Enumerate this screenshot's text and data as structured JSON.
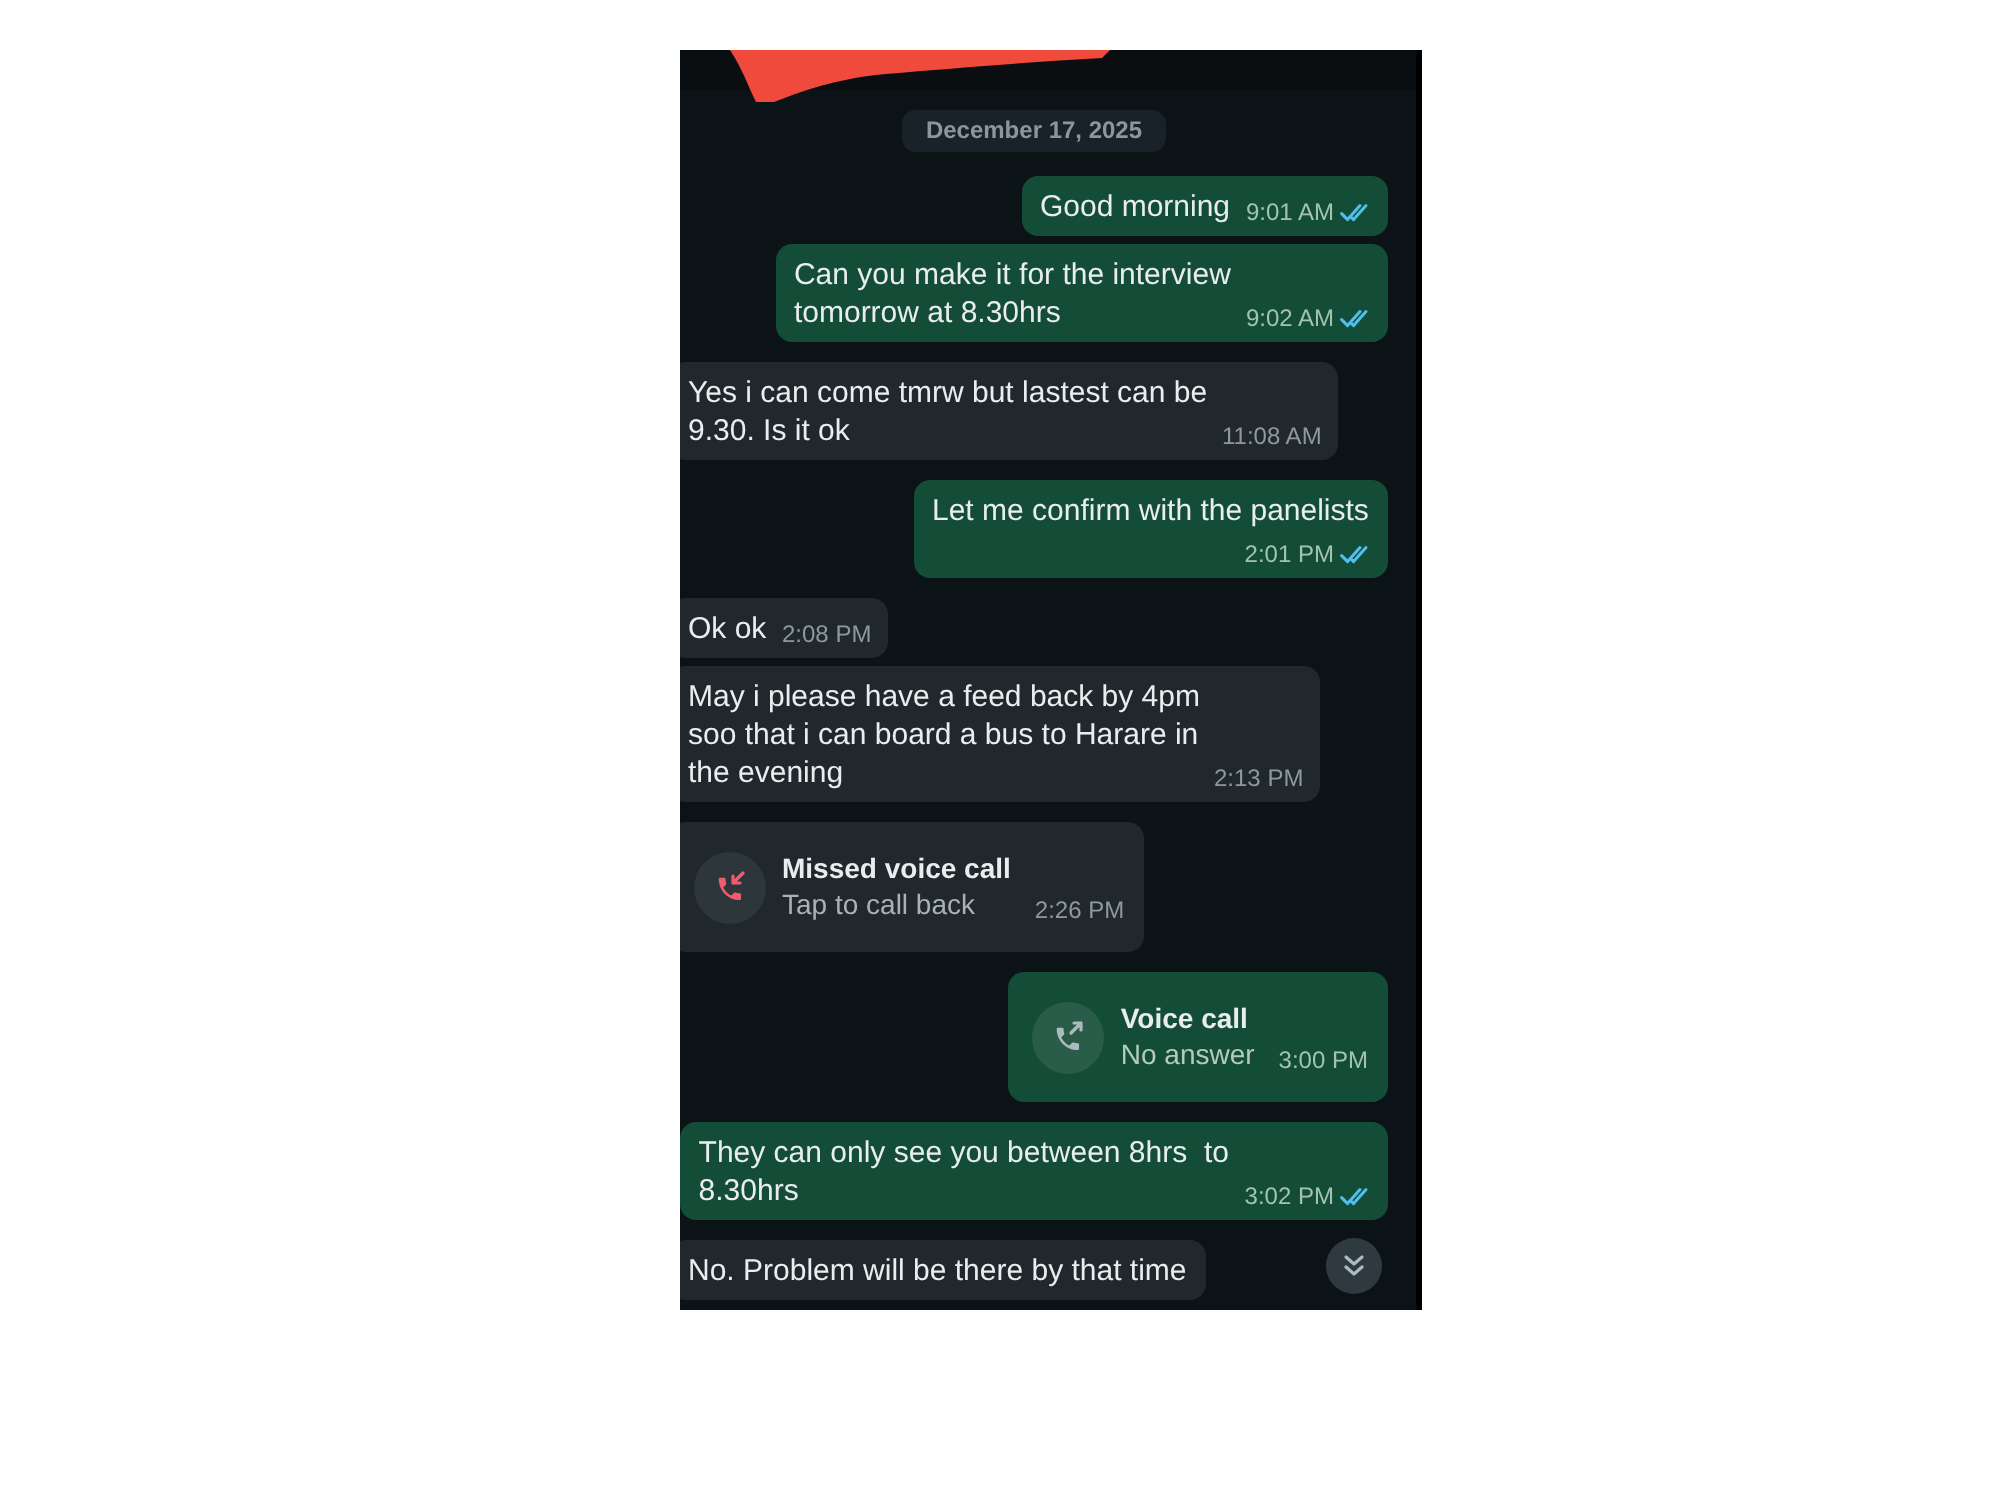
{
  "header": {
    "name_redacted": true
  },
  "date_chip": "December 17, 2025",
  "messages": [
    {
      "kind": "text",
      "outgoing": true,
      "text": "Good morning",
      "time": "9:01 AM",
      "read": true
    },
    {
      "kind": "text",
      "outgoing": true,
      "text": "Can you make it for the interview tomorrow at 8.30hrs",
      "time": "9:02 AM",
      "read": true
    },
    {
      "kind": "text",
      "outgoing": false,
      "text": "Yes i can come tmrw but lastest can be 9.30. Is it ok",
      "time": "11:08 AM"
    },
    {
      "kind": "text",
      "outgoing": true,
      "text": "Let me confirm with the panelists",
      "time": "2:01 PM",
      "read": true
    },
    {
      "kind": "text",
      "outgoing": false,
      "text": "Ok ok",
      "time": "2:08 PM"
    },
    {
      "kind": "text",
      "outgoing": false,
      "text": "May i please have a feed back by 4pm soo that i can board a bus to Harare in the evening",
      "time": "2:13 PM"
    },
    {
      "kind": "call",
      "outgoing": false,
      "title": "Missed voice call",
      "status": "Tap to call back",
      "time": "2:26 PM",
      "missed": true
    },
    {
      "kind": "call",
      "outgoing": true,
      "title": "Voice call",
      "status": "No answer",
      "time": "3:00 PM",
      "missed": false
    },
    {
      "kind": "text",
      "outgoing": true,
      "text": "They can only see you between 8hrs  to 8.30hrs",
      "time": "3:02 PM",
      "read": true
    },
    {
      "kind": "text",
      "outgoing": false,
      "text": "No. Problem will be there by that time"
    }
  ]
}
